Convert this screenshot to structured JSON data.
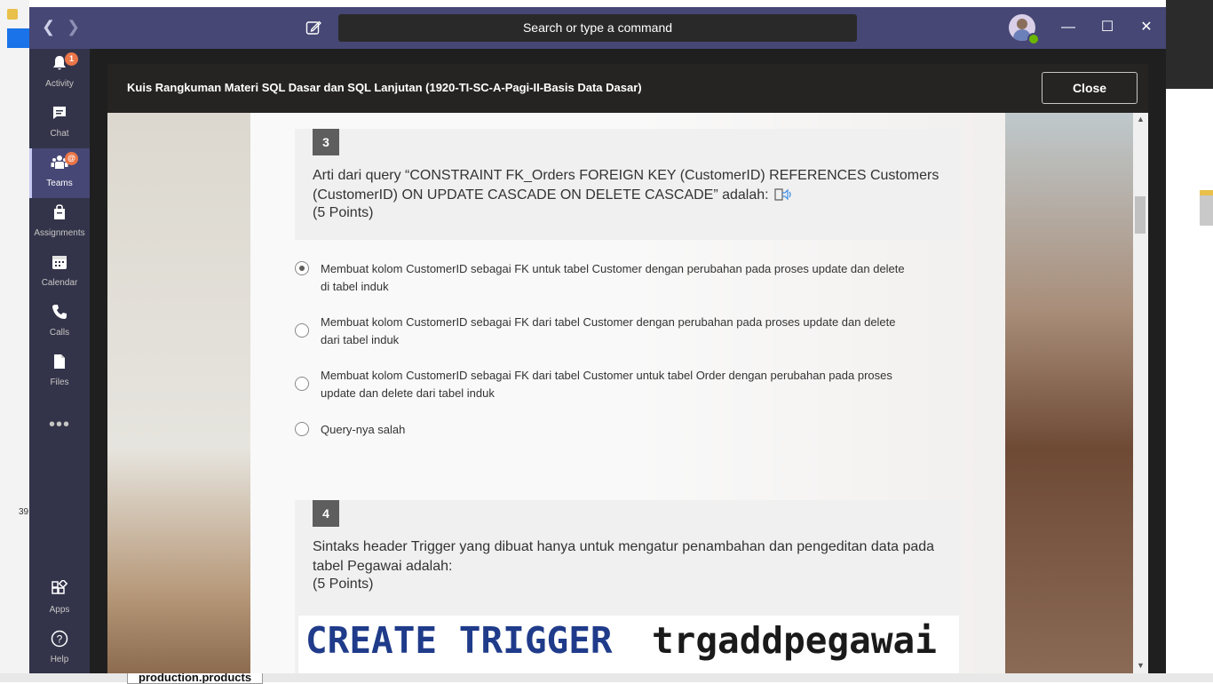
{
  "app": {
    "search_placeholder": "Search or type a command",
    "colors": {
      "titlebar": "#464775",
      "rail": "#33344a",
      "accent": "#c7c8f2",
      "badge": "#e97548",
      "presence": "#6bb700"
    }
  },
  "rail": {
    "items": [
      {
        "label": "Activity",
        "icon": "bell-icon",
        "badge": "1"
      },
      {
        "label": "Chat",
        "icon": "chat-icon"
      },
      {
        "label": "Teams",
        "icon": "teams-icon",
        "badge": "@"
      },
      {
        "label": "Assignments",
        "icon": "assignments-icon"
      },
      {
        "label": "Calendar",
        "icon": "calendar-icon"
      },
      {
        "label": "Calls",
        "icon": "phone-icon"
      },
      {
        "label": "Files",
        "icon": "file-icon"
      }
    ],
    "more": "•••",
    "bottom": [
      {
        "label": "Apps",
        "icon": "apps-icon"
      },
      {
        "label": "Help",
        "icon": "help-icon"
      }
    ]
  },
  "dialog": {
    "title": "Kuis Rangkuman Materi SQL Dasar dan SQL Lanjutan (1920-TI-SC-A-Pagi-II-Basis Data Dasar)",
    "close_label": "Close"
  },
  "questions": [
    {
      "number": "3",
      "text": "Arti dari query “CONSTRAINT FK_Orders FOREIGN KEY (CustomerID) REFERENCES Customers (CustomerID) ON UPDATE CASCADE ON DELETE CASCADE” adalah:",
      "points": "(5 Points)",
      "options": [
        {
          "text": "Membuat kolom CustomerID sebagai FK untuk tabel Customer dengan perubahan pada proses update dan delete di tabel induk",
          "selected": true
        },
        {
          "text": "Membuat kolom CustomerID sebagai FK dari tabel Customer dengan perubahan pada proses update dan delete dari tabel induk",
          "selected": false
        },
        {
          "text": "Membuat kolom CustomerID sebagai FK dari tabel Customer untuk tabel Order dengan perubahan pada proses update dan delete dari tabel induk",
          "selected": false
        },
        {
          "text": "Query-nya salah",
          "selected": false
        }
      ]
    },
    {
      "number": "4",
      "text": "Sintaks header Trigger yang dibuat hanya untuk mengatur penambahan dan pengeditan data pada tabel Pegawai adalah:",
      "points": "(5 Points)",
      "code_keyword": "CREATE TRIGGER",
      "code_name": "trgaddpegawai"
    }
  ],
  "background": {
    "left_number": "39",
    "taskbar_label": "production.products"
  }
}
